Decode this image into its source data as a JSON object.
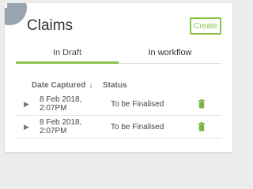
{
  "card": {
    "title": "Claims",
    "create_label": "Create",
    "tabs": [
      {
        "label": "In Draft",
        "active": true
      },
      {
        "label": "In workflow",
        "active": false
      }
    ]
  },
  "table": {
    "columns": [
      "Date Captured",
      "Status"
    ],
    "sort_indicator": "↓",
    "rows": [
      {
        "date": "8 Feb 2018, 2:07PM",
        "status": "To be Finalised"
      },
      {
        "date": "8 Feb 2018, 2:07PM",
        "status": "To be Finalised"
      }
    ]
  },
  "colors": {
    "accent": "#8bc34a",
    "corner_badge": "#9aa4b1"
  },
  "icons": {
    "corner": "clipboard-icon",
    "row_delete": "trash-icon",
    "row_expand": "caret-right-icon"
  }
}
